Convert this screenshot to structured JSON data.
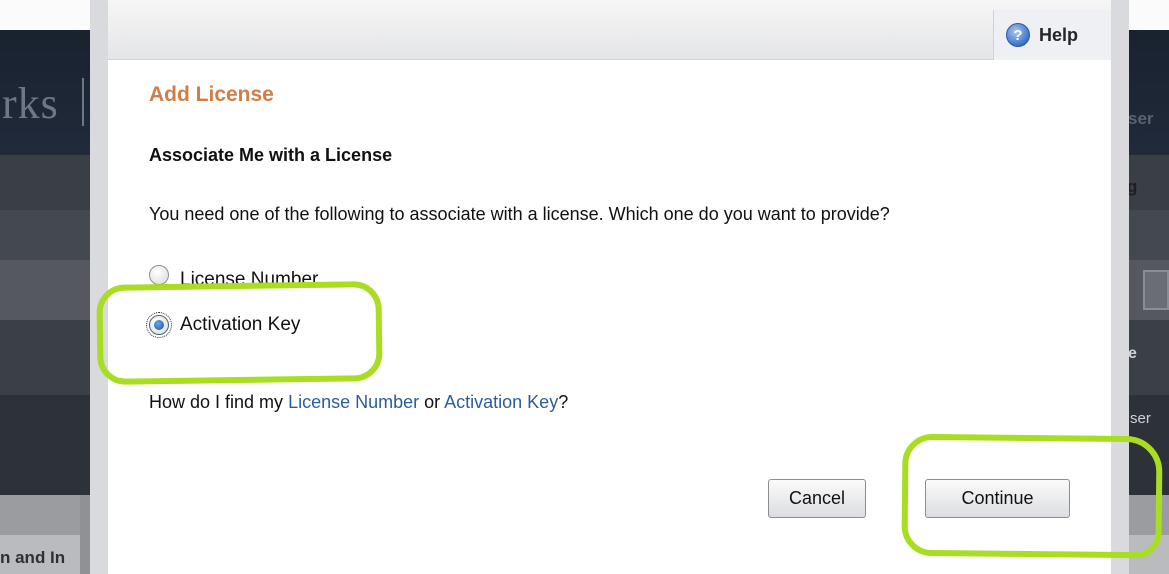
{
  "background": {
    "brand_fragment": "rks",
    "user_fragment_1": "ser",
    "nav_fragment": "g",
    "row_fragment": "e",
    "user_fragment_2": "ser",
    "bottom_fragment": "n and In"
  },
  "dialog": {
    "help_label": "Help",
    "title": "Add License",
    "subtitle": "Associate Me with a License",
    "question": "You need one of the following to associate with a license. Which one do you want to provide?",
    "options": [
      {
        "label": "License Number",
        "selected": false
      },
      {
        "label": "Activation Key",
        "selected": true
      }
    ],
    "help_text": {
      "prefix": "How do I find my ",
      "link1": "License Number",
      "middle": " or ",
      "link2": "Activation Key",
      "suffix": "?"
    },
    "buttons": {
      "cancel": "Cancel",
      "continue": "Continue"
    }
  },
  "colors": {
    "title": "#d07e46",
    "link": "#2a5e9e",
    "annotation": "#a8dd22"
  }
}
